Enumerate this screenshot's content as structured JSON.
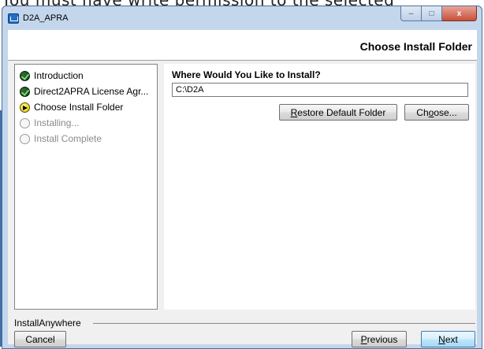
{
  "background": {
    "caption": "You must have write permission to the selected"
  },
  "window": {
    "title": "D2A_APRA",
    "caption_buttons": {
      "minimize": "–",
      "maximize": "□",
      "close": "x"
    }
  },
  "header": {
    "title": "Choose Install Folder"
  },
  "steps": [
    {
      "label": "Introduction",
      "state": "done"
    },
    {
      "label": "Direct2APRA License Agr...",
      "state": "done"
    },
    {
      "label": "Choose Install Folder",
      "state": "current"
    },
    {
      "label": "Installing...",
      "state": "pending"
    },
    {
      "label": "Install Complete",
      "state": "pending"
    }
  ],
  "main": {
    "question": "Where Would You Like to Install?",
    "path_value": "C:\\D2A",
    "restore_button": {
      "mnemonic": "R",
      "rest": "estore Default Folder"
    },
    "choose_button": {
      "pre": "Ch",
      "mnemonic": "o",
      "rest": "ose..."
    }
  },
  "footer": {
    "brand": "InstallAnywhere",
    "cancel": "Cancel",
    "previous": {
      "mnemonic": "P",
      "rest": "revious"
    },
    "next": {
      "mnemonic": "N",
      "rest": "ext"
    }
  },
  "icons": {
    "done": "green-check-icon",
    "current": "yellow-arrow-icon",
    "pending": "empty-circle-icon"
  },
  "colors": {
    "titlebar": "#c3d6ec",
    "accent_button": "#a7d9f5",
    "close_button": "#c7513a"
  }
}
